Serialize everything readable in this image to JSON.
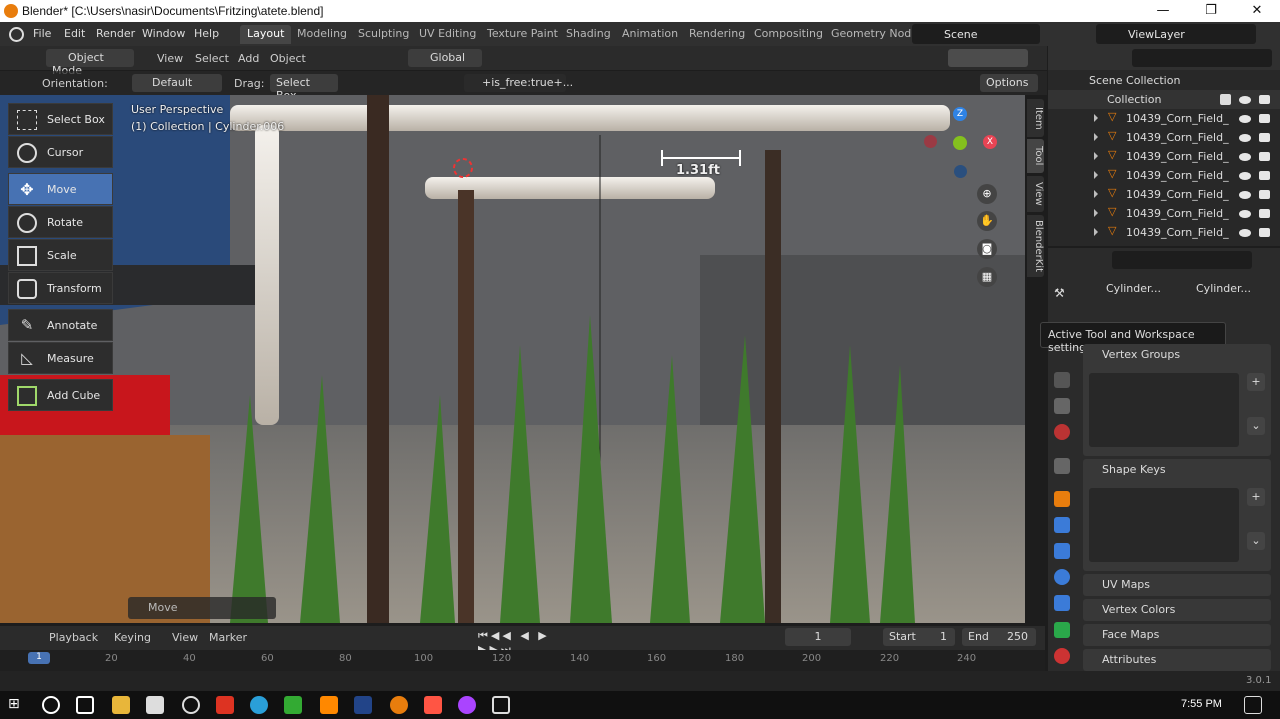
{
  "window": {
    "title": "Blender* [C:\\Users\\nasir\\Documents\\Fritzing\\atete.blend]",
    "min": "—",
    "max": "❐",
    "close": "✕"
  },
  "menu": [
    "File",
    "Edit",
    "Render",
    "Window",
    "Help"
  ],
  "workspaces": [
    "Layout",
    "Modeling",
    "Sculpting",
    "UV Editing",
    "Texture Paint",
    "Shading",
    "Animation",
    "Rendering",
    "Compositing",
    "Geometry Nod"
  ],
  "active_workspace": "Layout",
  "scene": "Scene",
  "view_layer": "ViewLayer",
  "viewport_header": {
    "mode": "Object Mode",
    "view": "View",
    "select": "Select",
    "add": "Add",
    "object": "Object",
    "transform": "Global"
  },
  "tool_settings": {
    "orientation_label": "Orientation:",
    "orientation": "Default",
    "drag_label": "Drag:",
    "drag": "Select Box",
    "filter": "+is_free:true+...",
    "options": "Options"
  },
  "tools": [
    {
      "label": "Select Box"
    },
    {
      "label": "Cursor"
    },
    {
      "label": "Move"
    },
    {
      "label": "Rotate"
    },
    {
      "label": "Scale"
    },
    {
      "label": "Transform"
    },
    {
      "label": "Annotate"
    },
    {
      "label": "Measure"
    },
    {
      "label": "Add Cube"
    }
  ],
  "viewport": {
    "perspective": "User Perspective",
    "context": "(1) Collection | Cylinder.006",
    "measure": "1.31ft",
    "last_op": "Move"
  },
  "gizmo": {
    "x": "X",
    "y": "Y",
    "z": "Z"
  },
  "side_tabs": [
    "Item",
    "Tool",
    "View",
    "BlenderKit"
  ],
  "outliner": {
    "scene_collection": "Scene Collection",
    "collection": "Collection",
    "items": [
      "10439_Corn_Field_",
      "10439_Corn_Field_",
      "10439_Corn_Field_",
      "10439_Corn_Field_",
      "10439_Corn_Field_",
      "10439_Corn_Field_",
      "10439_Corn_Field_"
    ]
  },
  "properties": {
    "breadcrumb_obj": "Cylinder...",
    "breadcrumb_data": "Cylinder...",
    "tooltip": "Active Tool and Workspace settings",
    "panels": [
      "Vertex Groups",
      "Shape Keys",
      "UV Maps",
      "Vertex Colors",
      "Face Maps",
      "Attributes"
    ]
  },
  "timeline": {
    "playback": "Playback",
    "keying": "Keying",
    "view": "View",
    "marker": "Marker",
    "current_frame": "1",
    "start_label": "Start",
    "start": "1",
    "end_label": "End",
    "end": "250",
    "ticks": [
      "1",
      "20",
      "40",
      "60",
      "80",
      "100",
      "120",
      "140",
      "160",
      "180",
      "200",
      "220",
      "240"
    ]
  },
  "status": {
    "version": "3.0.1"
  },
  "taskbar": {
    "time": "7:55 PM"
  },
  "colors": {
    "accent": "#4772b3",
    "active_ws": "#454545",
    "bg": "#303030",
    "gizmo_x": "#e84454",
    "gizmo_y": "#84c01e",
    "gizmo_z": "#2f83e5",
    "blender_orange": "#e87d0d"
  }
}
